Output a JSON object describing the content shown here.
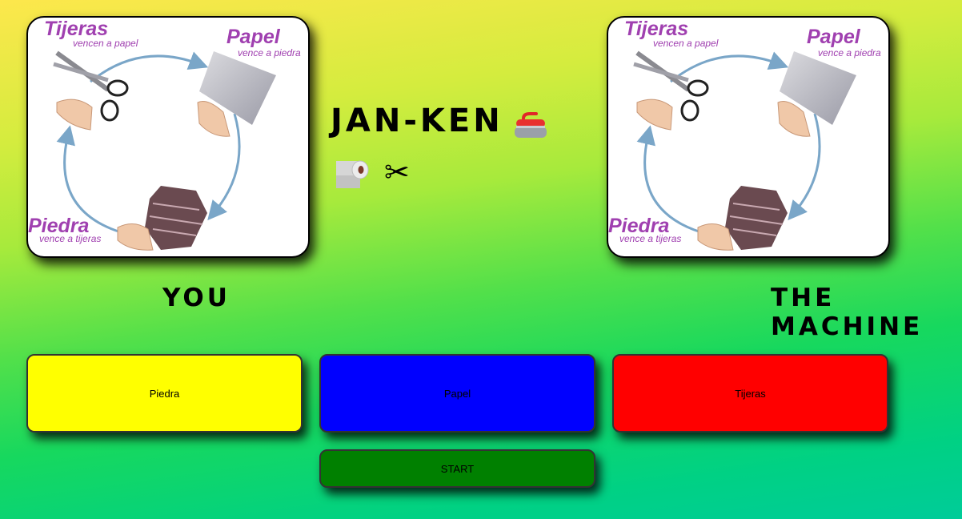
{
  "diagram": {
    "tijeras": "Tijeras",
    "tijeras_sub": "vencen a papel",
    "papel": "Papel",
    "papel_sub": "vence a piedra",
    "piedra": "Piedra",
    "piedra_sub": "vence a tijeras"
  },
  "header": {
    "title": "JAN-KEN",
    "icons": [
      "curling-stone-icon",
      "toilet-paper-icon",
      "scissors-icon"
    ],
    "scissors_glyph": "✂"
  },
  "players": {
    "you": "YOU",
    "machine": "THE MACHINE"
  },
  "buttons": {
    "piedra": "Piedra",
    "papel": "Papel",
    "tijeras": "Tijeras",
    "start": "START"
  },
  "colors": {
    "piedra": "#ffff00",
    "papel": "#0000ff",
    "tijeras": "#ff0000",
    "start": "#008000",
    "diagram_text": "#a040b0",
    "arrow": "#7aa6c8"
  }
}
